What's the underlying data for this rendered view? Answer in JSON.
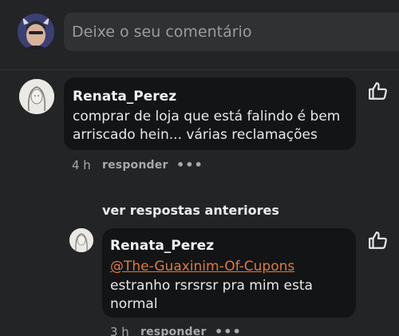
{
  "composer": {
    "placeholder": "Deixe o seu comentário"
  },
  "comment": {
    "author": "Renata_Perez",
    "text_line1": "comprar de loja que está falindo é bem",
    "text_line2": "arriscado hein... várias reclamações",
    "time": "4 h",
    "reply_label": "responder",
    "more_label": "•••"
  },
  "thread": {
    "previous_replies_label": "ver respostas anteriores"
  },
  "reply": {
    "author": "Renata_Perez",
    "mention": "@The-Guaxinim-Of-Cupons",
    "text_line1": "estranho rsrsrsr pra mim esta",
    "text_line2": "normal",
    "time": "3 h",
    "reply_label": "responder",
    "more_label": "•••"
  },
  "colors": {
    "background": "#222426",
    "bubble": "#131416",
    "mention": "#e07a3a",
    "muted": "#a7a9ab"
  },
  "icons": [
    "thumbs-up-icon",
    "more-options-icon"
  ]
}
